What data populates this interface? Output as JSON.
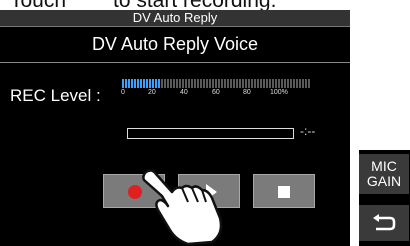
{
  "caption": {
    "prefix": "Touch",
    "suffix": "to start recording."
  },
  "window": {
    "title": "DV Auto Reply",
    "heading": "DV Auto Reply Voice"
  },
  "rec_level": {
    "label": "REC Level :",
    "scale": [
      "0",
      "20",
      "40",
      "60",
      "80",
      "100%"
    ],
    "level_fraction": 0.2
  },
  "recording": {
    "progress_fraction": 0.0,
    "time": "-:--"
  },
  "controls": [
    {
      "name": "record",
      "icon": "record-icon"
    },
    {
      "name": "play",
      "icon": "play-icon"
    },
    {
      "name": "stop",
      "icon": "stop-icon"
    }
  ],
  "side_buttons": {
    "mic_gain_line1": "MIC",
    "mic_gain_line2": "GAIN",
    "back_icon": "return-icon"
  },
  "colors": {
    "record": "#e02020",
    "meter_active": "#3aa0ff"
  }
}
